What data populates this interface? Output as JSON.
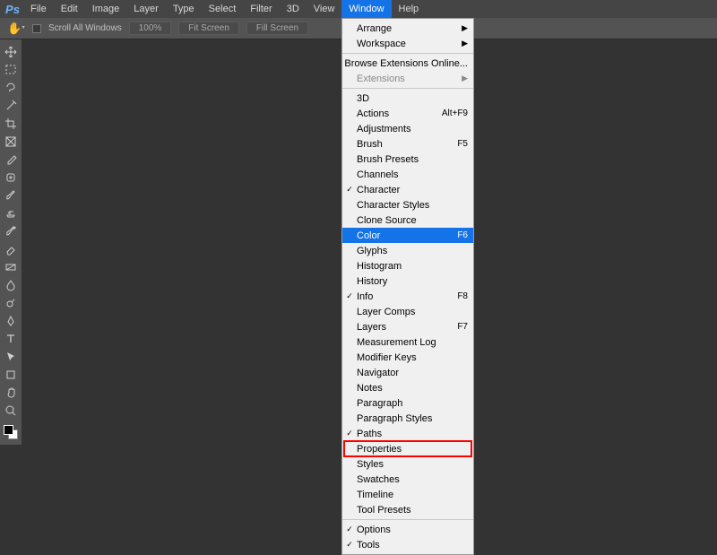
{
  "app": {
    "logo_text": "Ps"
  },
  "menubar": {
    "items": [
      {
        "label": "File"
      },
      {
        "label": "Edit"
      },
      {
        "label": "Image"
      },
      {
        "label": "Layer"
      },
      {
        "label": "Type"
      },
      {
        "label": "Select"
      },
      {
        "label": "Filter"
      },
      {
        "label": "3D"
      },
      {
        "label": "View"
      },
      {
        "label": "Window",
        "active": true
      },
      {
        "label": "Help"
      }
    ]
  },
  "optionsbar": {
    "scroll_all_windows_label": "Scroll All Windows",
    "zoom_value": "100%",
    "fit_label": "Fit Screen",
    "fill_label": "Fill Screen"
  },
  "window_menu": {
    "items": [
      {
        "label": "Arrange",
        "submenu": true
      },
      {
        "label": "Workspace",
        "submenu": true
      },
      {
        "label": "-"
      },
      {
        "label": "Browse Extensions Online..."
      },
      {
        "label": "Extensions",
        "submenu": true,
        "disabled": true
      },
      {
        "label": "-"
      },
      {
        "label": "3D"
      },
      {
        "label": "Actions",
        "shortcut": "Alt+F9"
      },
      {
        "label": "Adjustments"
      },
      {
        "label": "Brush",
        "shortcut": "F5"
      },
      {
        "label": "Brush Presets"
      },
      {
        "label": "Channels"
      },
      {
        "label": "Character",
        "checked": true
      },
      {
        "label": "Character Styles"
      },
      {
        "label": "Clone Source"
      },
      {
        "label": "Color",
        "shortcut": "F6",
        "selected": true
      },
      {
        "label": "Glyphs"
      },
      {
        "label": "Histogram"
      },
      {
        "label": "History"
      },
      {
        "label": "Info",
        "shortcut": "F8",
        "checked": true
      },
      {
        "label": "Layer Comps"
      },
      {
        "label": "Layers",
        "shortcut": "F7"
      },
      {
        "label": "Measurement Log"
      },
      {
        "label": "Modifier Keys"
      },
      {
        "label": "Navigator"
      },
      {
        "label": "Notes"
      },
      {
        "label": "Paragraph"
      },
      {
        "label": "Paragraph Styles"
      },
      {
        "label": "Paths",
        "checked": true
      },
      {
        "label": "Properties",
        "highlighted_red": true
      },
      {
        "label": "Styles"
      },
      {
        "label": "Swatches"
      },
      {
        "label": "Timeline"
      },
      {
        "label": "Tool Presets"
      },
      {
        "label": "-"
      },
      {
        "label": "Options",
        "checked": true
      },
      {
        "label": "Tools",
        "checked": true
      }
    ]
  },
  "tools": {
    "items": [
      {
        "name": "move-tool"
      },
      {
        "name": "marquee-tool"
      },
      {
        "name": "lasso-tool"
      },
      {
        "name": "magic-wand-tool"
      },
      {
        "name": "crop-tool"
      },
      {
        "name": "frame-tool"
      },
      {
        "name": "eyedropper-tool"
      },
      {
        "name": "healing-brush-tool"
      },
      {
        "name": "brush-tool"
      },
      {
        "name": "clone-stamp-tool"
      },
      {
        "name": "history-brush-tool"
      },
      {
        "name": "eraser-tool"
      },
      {
        "name": "gradient-tool"
      },
      {
        "name": "blur-tool"
      },
      {
        "name": "dodge-tool"
      },
      {
        "name": "pen-tool"
      },
      {
        "name": "type-tool"
      },
      {
        "name": "path-selection-tool"
      },
      {
        "name": "shape-tool"
      },
      {
        "name": "hand-tool"
      },
      {
        "name": "zoom-tool"
      }
    ]
  }
}
